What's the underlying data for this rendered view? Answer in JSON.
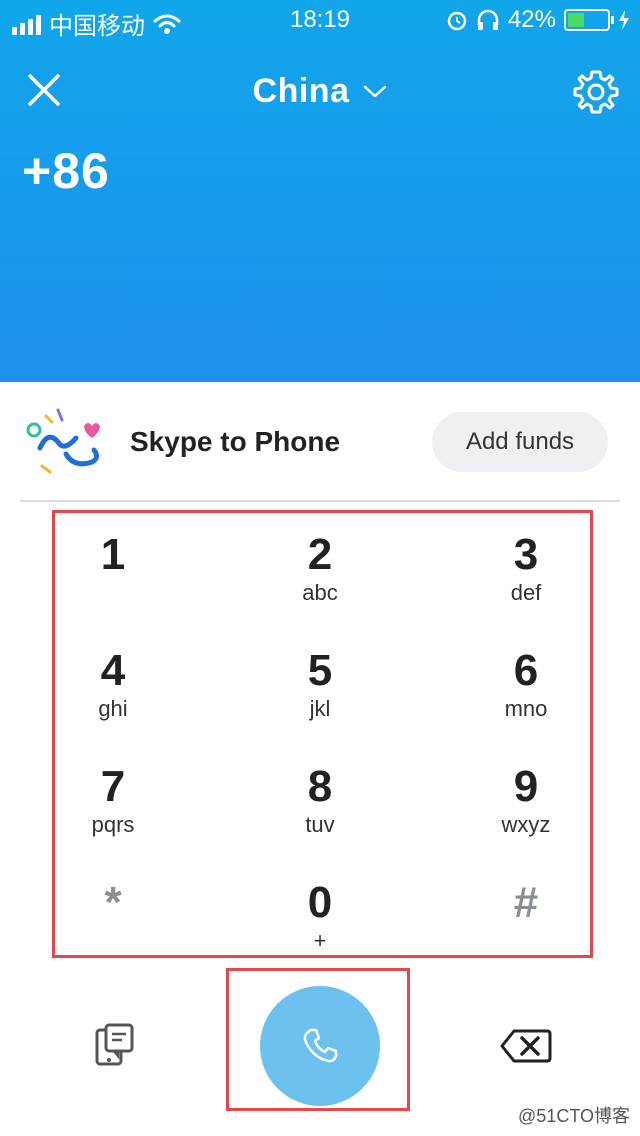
{
  "status_bar": {
    "carrier": "中国移动",
    "time": "18:19",
    "battery_percent": "42%",
    "battery_level": 0.42
  },
  "header": {
    "country": "China",
    "dial_prefix": "+86",
    "background_color": "#1a9ceb"
  },
  "promo": {
    "title": "Skype to Phone",
    "add_funds_label": "Add funds"
  },
  "keypad": {
    "keys": [
      {
        "digit": "1",
        "letters": ""
      },
      {
        "digit": "2",
        "letters": "abc"
      },
      {
        "digit": "3",
        "letters": "def"
      },
      {
        "digit": "4",
        "letters": "ghi"
      },
      {
        "digit": "5",
        "letters": "jkl"
      },
      {
        "digit": "6",
        "letters": "mno"
      },
      {
        "digit": "7",
        "letters": "pqrs"
      },
      {
        "digit": "8",
        "letters": "tuv"
      },
      {
        "digit": "9",
        "letters": "wxyz"
      },
      {
        "digit": "*",
        "letters": ""
      },
      {
        "digit": "0",
        "letters": "+"
      },
      {
        "digit": "#",
        "letters": ""
      }
    ]
  },
  "actions": {
    "call_color": "#6cc1ee",
    "highlight_color": "#e0484c"
  },
  "watermark": "@51CTO博客",
  "icons": {
    "close": "close-icon",
    "settings": "gear-icon",
    "dropdown": "chevron-down-icon",
    "call": "phone-icon",
    "contacts": "contacts-icon",
    "backspace": "backspace-icon"
  }
}
